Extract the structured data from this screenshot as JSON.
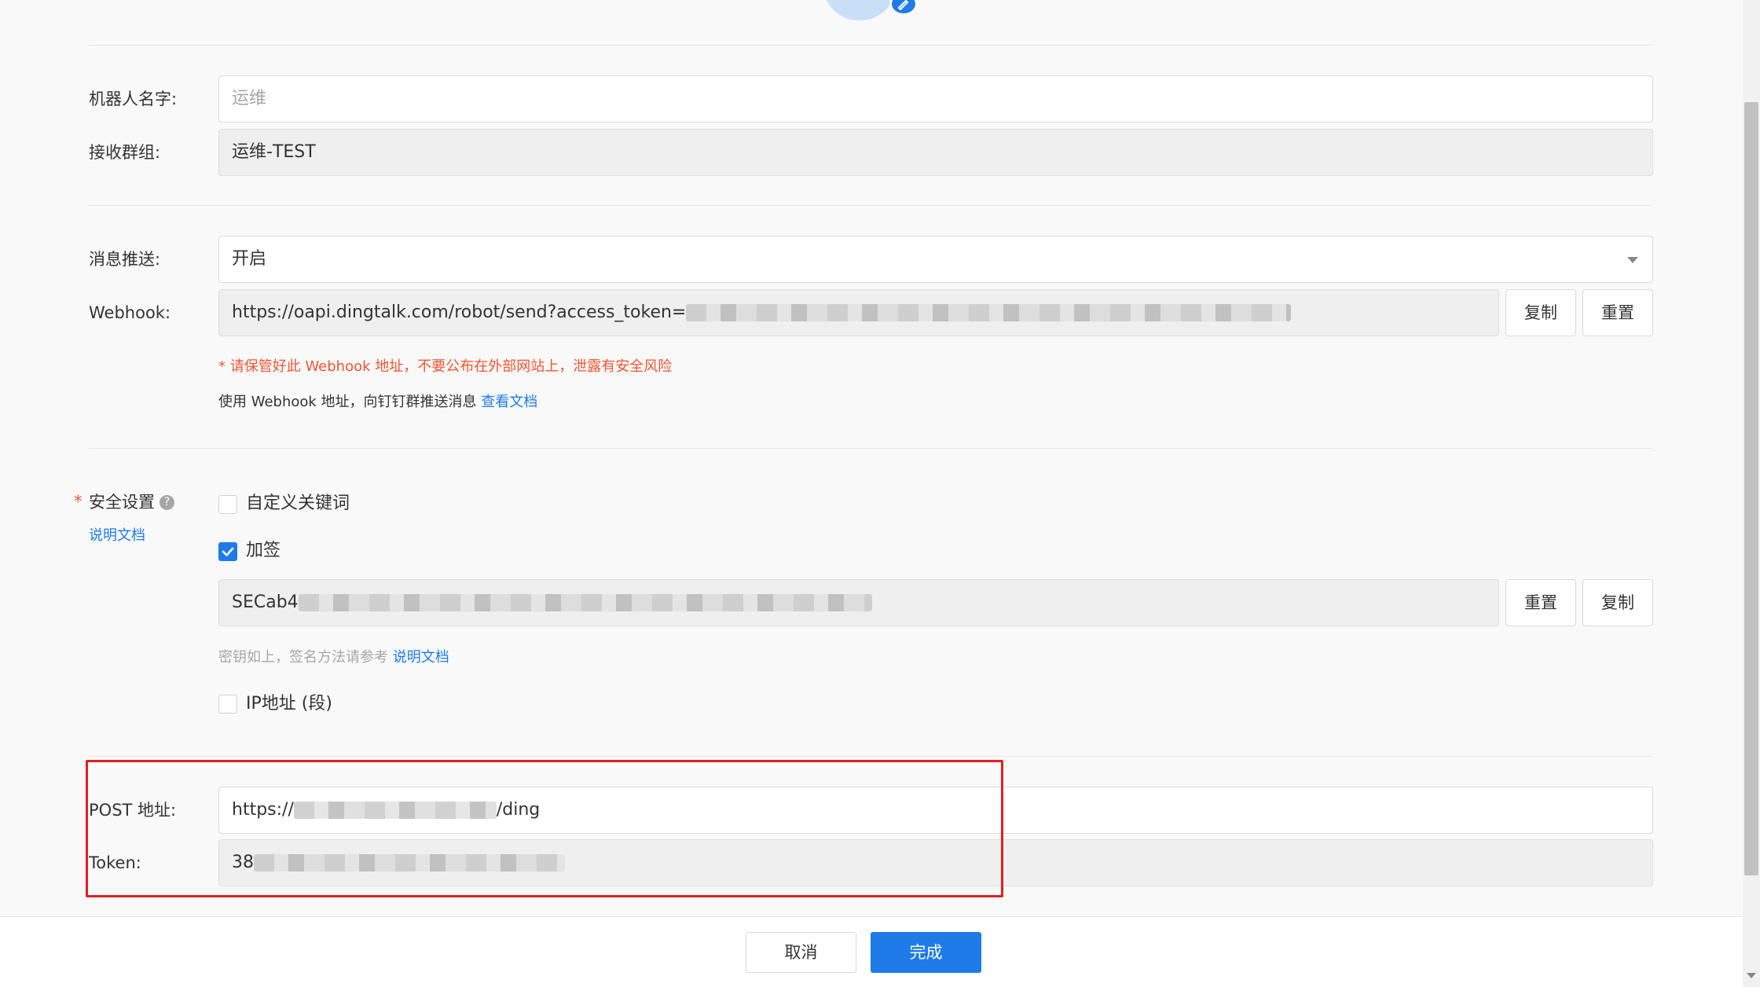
{
  "form": {
    "robot_name_label": "机器人名字:",
    "robot_name_placeholder": "运维",
    "group_label": "接收群组:",
    "group_value": "运维-TEST",
    "push_label": "消息推送:",
    "push_value": "开启",
    "webhook_label": "Webhook:",
    "webhook_value": "https://oapi.dingtalk.com/robot/send?access_token=",
    "webhook_copy_label": "复制",
    "webhook_reset_label": "重置",
    "webhook_warning": "* 请保管好此 Webhook 地址，不要公布在外部网站上，泄露有安全风险",
    "webhook_help_text": "使用 Webhook 地址，向钉钉群推送消息",
    "webhook_help_link": "查看文档"
  },
  "security": {
    "required_mark": "*",
    "label": "安全设置",
    "doc_link": "说明文档",
    "options": {
      "keyword_label": "自定义关键词",
      "keyword_checked": false,
      "sign_label": "加签",
      "sign_checked": true,
      "ip_label": "IP地址 (段)",
      "ip_checked": false
    },
    "secret_value": "SECab4",
    "secret_reset_label": "重置",
    "secret_copy_label": "复制",
    "secret_help_text": "密钥如上，签名方法请参考",
    "secret_help_link": "说明文档"
  },
  "post": {
    "url_label": "POST 地址:",
    "url_prefix": "https://",
    "url_suffix": "/ding",
    "token_label": "Token:",
    "token_value": "38"
  },
  "footer": {
    "cancel_label": "取消",
    "done_label": "完成"
  },
  "colors": {
    "accent": "#1f7be8",
    "warning": "#f15533",
    "highlight_box": "#e02020"
  }
}
